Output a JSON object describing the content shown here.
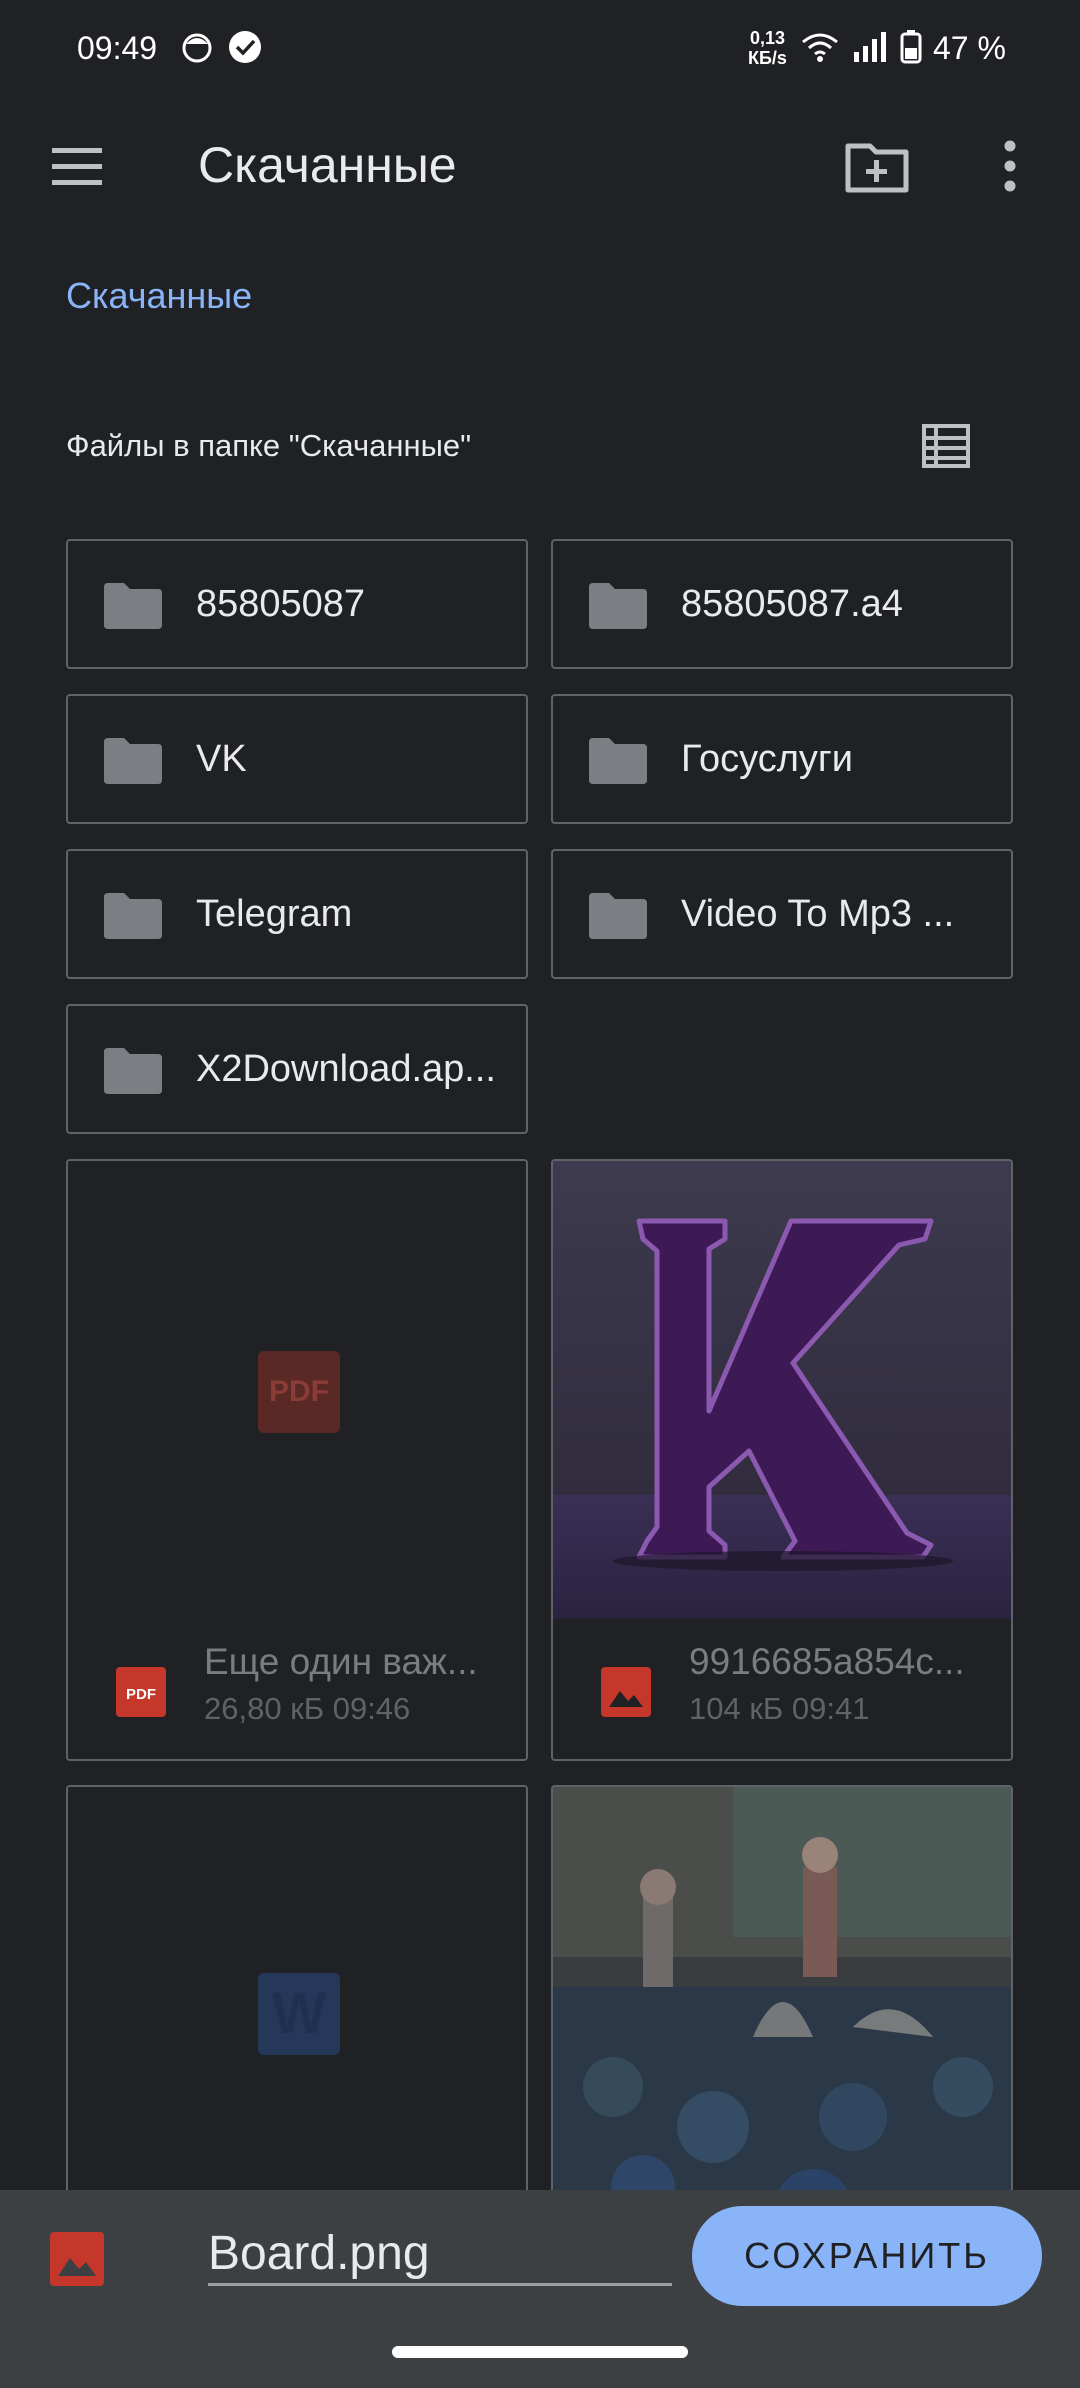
{
  "status_bar": {
    "time": "09:49",
    "net_speed_value": "0,13",
    "net_speed_unit": "КБ/s",
    "battery": "47 %"
  },
  "app_bar": {
    "title": "Скачанные"
  },
  "breadcrumb": "Скачанные",
  "section_header": "Файлы в папке \"Скачанные\"",
  "folders": [
    {
      "name": "85805087"
    },
    {
      "name": "85805087.a4"
    },
    {
      "name": "VK"
    },
    {
      "name": "Госуслуги"
    },
    {
      "name": "Telegram"
    },
    {
      "name": "Video To Mp3 ..."
    },
    {
      "name": "X2Download.ap..."
    }
  ],
  "files": [
    {
      "name": "Еще один важ...",
      "sub": "26,80 кБ 09:46",
      "type": "pdf",
      "icon": "pdf-icon"
    },
    {
      "name": "9916685a854c...",
      "sub": "104 кБ 09:41",
      "type": "image",
      "icon": "image-icon"
    },
    {
      "name": "",
      "sub": "",
      "type": "word",
      "icon": "word-icon"
    },
    {
      "name": "",
      "sub": "",
      "type": "image",
      "icon": "image-icon"
    }
  ],
  "thumb_labels": {
    "pdf": "PDF",
    "word": "W"
  },
  "save_bar": {
    "filename": "Board.png",
    "save_label": "СОХРАНИТЬ"
  },
  "colors": {
    "background": "#202124",
    "accent": "#8ab4f8",
    "pdf_red": "#d93025",
    "word_blue": "#1a73e8"
  }
}
